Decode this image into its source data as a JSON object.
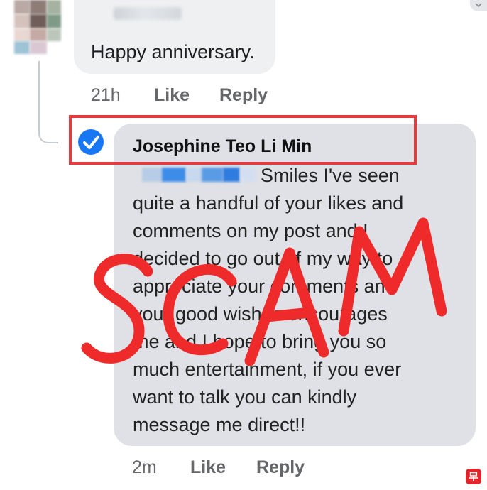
{
  "comment1": {
    "text": "Happy anniversary.",
    "time": "21h",
    "like_label": "Like",
    "reply_label": "Reply"
  },
  "comment2": {
    "author": "Josephine Teo Li Min",
    "lines": [
      "Smiles I've seen",
      "quite a handful of your likes and",
      "comments on my post and I",
      "decided to go out of my way to",
      "appreciate your comments and",
      "your good wishes encourages",
      "me and I hope to bring you so",
      "much entertainment, if you ever",
      "want to talk you can kindly",
      "message me direct!!"
    ],
    "time": "2m",
    "like_label": "Like",
    "reply_label": "Reply"
  },
  "overlay": {
    "stamp_text": "SCAM",
    "stamp_color": "#ee2a2a",
    "highlight_color": "#e63a3c"
  },
  "icons": {
    "verified": "verified-check-icon",
    "corner": "chevron-down-icon",
    "watermark": "publisher-logo-icon"
  },
  "colors": {
    "bubble": "#dfe1e6",
    "meta_text": "#65676b",
    "verified_blue": "#1877f2"
  }
}
